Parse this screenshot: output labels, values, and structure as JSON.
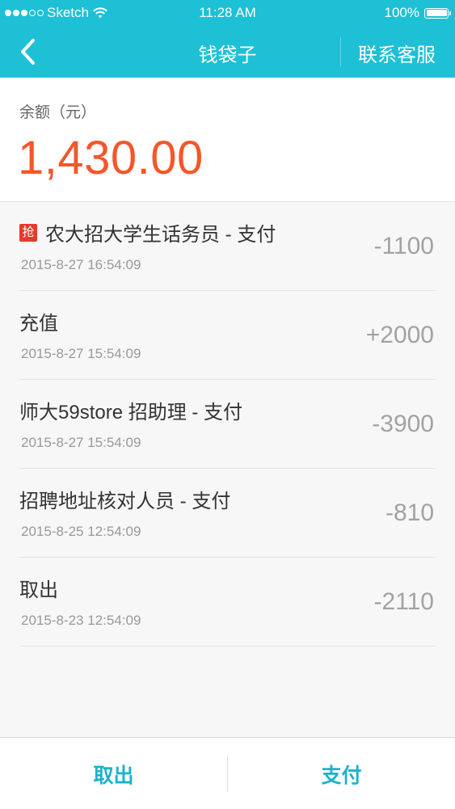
{
  "status_bar": {
    "carrier": "Sketch",
    "time": "11:28 AM",
    "battery": "100%",
    "wifi_icon": "wifi-icon",
    "battery_icon": "battery-icon"
  },
  "nav": {
    "title": "钱袋子",
    "right_label": "联系客服",
    "back_icon": "chevron-left-icon"
  },
  "balance": {
    "label": "余额（元）",
    "value": "1,430.00"
  },
  "transactions": [
    {
      "badge": "抢",
      "title": "农大招大学生话务员 - 支付",
      "date": "2015-8-27 16:54:09",
      "amount": "-1100"
    },
    {
      "badge": "",
      "title": "充值",
      "date": "2015-8-27 15:54:09",
      "amount": "+2000"
    },
    {
      "badge": "",
      "title": "师大59store 招助理 - 支付",
      "date": "2015-8-27 15:54:09",
      "amount": "-3900"
    },
    {
      "badge": "",
      "title": "招聘地址核对人员 - 支付",
      "date": "2015-8-25 12:54:09",
      "amount": "-810"
    },
    {
      "badge": "",
      "title": "取出",
      "date": "2015-8-23 12:54:09",
      "amount": "-2110"
    }
  ],
  "bottom_bar": {
    "withdraw_label": "取出",
    "pay_label": "支付"
  },
  "colors": {
    "primary": "#1ec0d6",
    "balance": "#f5562a",
    "badge": "#e53b2c",
    "bottom_button": "#1ab3cc"
  }
}
